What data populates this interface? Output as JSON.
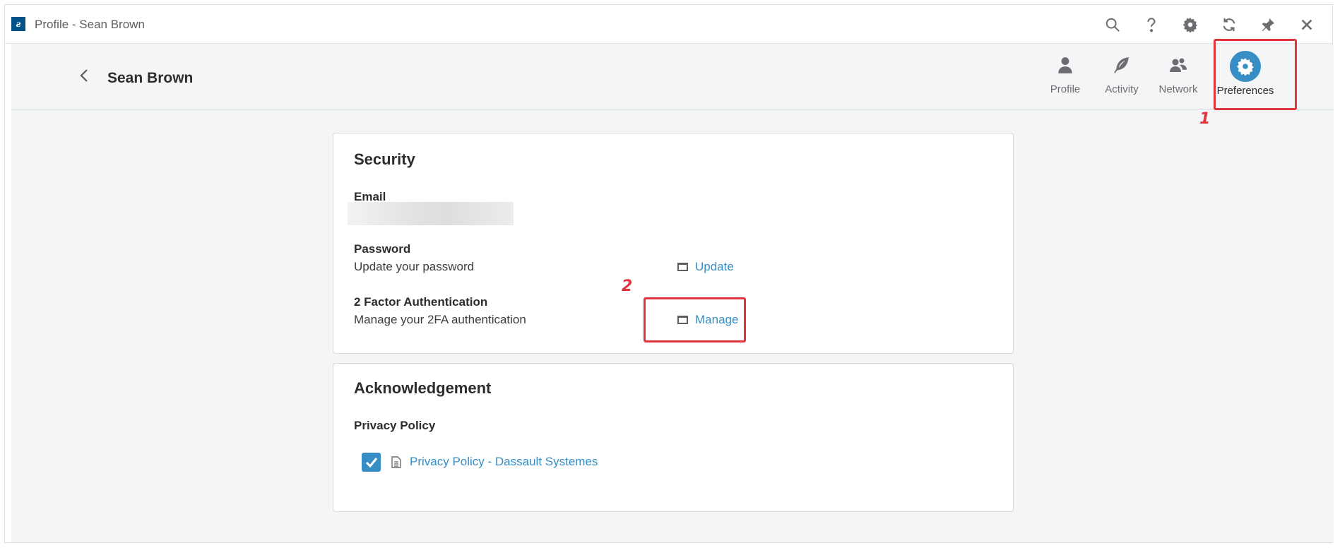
{
  "window": {
    "title": "Profile - Sean Brown",
    "logo_text": "ƨ",
    "toolbar_icons": [
      "search-icon",
      "help-icon",
      "gear-icon",
      "refresh-icon",
      "pin-icon",
      "close-icon"
    ]
  },
  "header": {
    "title": "Sean Brown",
    "tabs": [
      {
        "label": "Profile",
        "icon": "user-icon"
      },
      {
        "label": "Activity",
        "icon": "feather-icon"
      },
      {
        "label": "Network",
        "icon": "users-icon"
      },
      {
        "label": "Preferences",
        "icon": "gear-icon",
        "active": true
      }
    ]
  },
  "annotations": {
    "one": "1",
    "two": "2",
    "color": "#e0353c"
  },
  "security": {
    "title": "Security",
    "email_label": "Email",
    "password_label": "Password",
    "password_desc": "Update your password",
    "password_action": "Update",
    "twofa_label": "2 Factor Authentication",
    "twofa_desc": "Manage your 2FA authentication",
    "twofa_action": "Manage"
  },
  "acknowledgement": {
    "title": "Acknowledgement",
    "privacy_label": "Privacy Policy",
    "privacy_link": "Privacy Policy - Dassault Systemes",
    "privacy_checked": true
  },
  "colors": {
    "accent": "#368ec4",
    "background": "#f4f5f6",
    "annotation": "#e0353c"
  }
}
